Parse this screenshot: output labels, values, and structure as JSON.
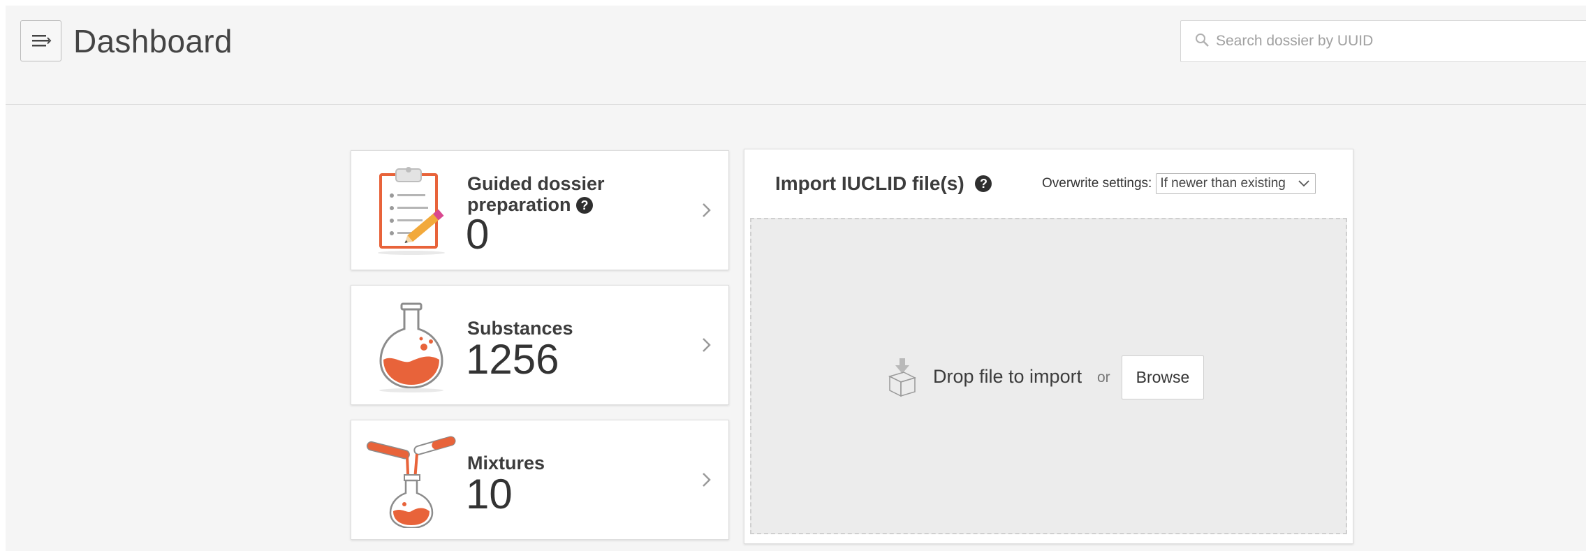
{
  "header": {
    "title": "Dashboard",
    "menu_icon": "menu-icon",
    "search": {
      "placeholder": "Search dossier by UUID",
      "value": ""
    }
  },
  "cards": {
    "guided": {
      "title_line1": "Guided dossier",
      "title_line2": "preparation",
      "help": "?",
      "count": "0",
      "icon": "clipboard-pencil-icon"
    },
    "substances": {
      "title": "Substances",
      "count": "1256",
      "icon": "flask-icon"
    },
    "mixtures": {
      "title": "Mixtures",
      "count": "10",
      "icon": "mixing-tubes-icon"
    }
  },
  "import": {
    "title": "Import IUCLID file(s)",
    "help": "?",
    "overwrite_label": "Overwrite settings:",
    "overwrite_value": "If newer than existing",
    "drop_text": "Drop file to import",
    "or_text": "or",
    "browse_label": "Browse"
  },
  "colors": {
    "accent": "#e8633a",
    "background": "#f5f5f5",
    "card": "#ffffff"
  }
}
